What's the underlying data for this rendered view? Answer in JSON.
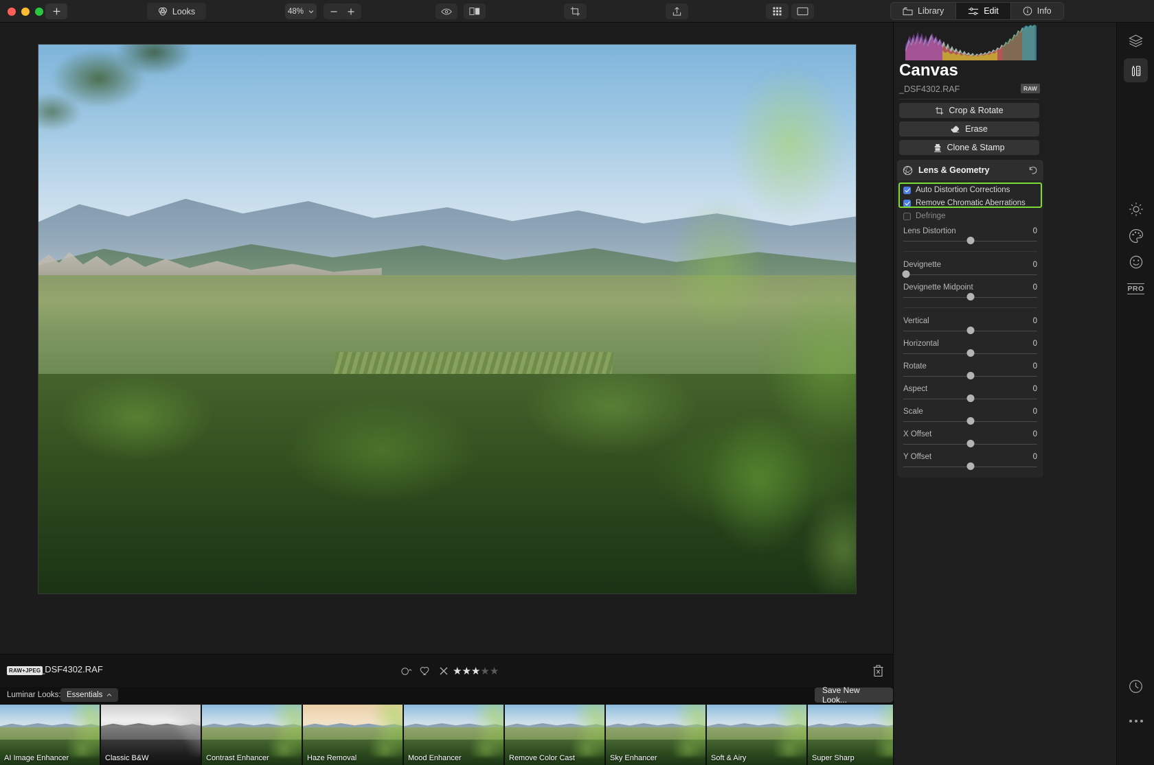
{
  "titlebar": {
    "add_label": "+",
    "looks_label": "Looks",
    "zoom_label": "48%",
    "minus_label": "−",
    "plus_label": "+",
    "icons": {
      "eye": "eye-icon",
      "compare": "before-after-icon",
      "crop": "crop-icon",
      "share": "share-icon",
      "grid": "grid-view-icon",
      "single": "single-view-icon"
    },
    "segments": [
      {
        "label": "Library",
        "icon": "library-icon",
        "active": false
      },
      {
        "label": "Edit",
        "icon": "sliders-icon",
        "active": true
      },
      {
        "label": "Info",
        "icon": "info-icon",
        "active": false
      }
    ]
  },
  "panel": {
    "title": "Canvas",
    "filename": "_DSF4302.RAF",
    "raw_badge": "RAW",
    "tools": [
      {
        "label": "Crop & Rotate",
        "icon": "crop-icon"
      },
      {
        "label": "Erase",
        "icon": "eraser-icon"
      },
      {
        "label": "Clone & Stamp",
        "icon": "stamp-icon"
      }
    ],
    "module": {
      "title": "Lens & Geometry",
      "icon": "aperture-icon",
      "reset_icon": "reset-arrow-icon",
      "highlight_color": "#7ddb34",
      "checkboxes": [
        {
          "label": "Auto Distortion Corrections",
          "checked": true,
          "dim": false
        },
        {
          "label": "Remove Chromatic Aberrations",
          "checked": true,
          "dim": false
        },
        {
          "label": "Defringe",
          "checked": false,
          "dim": true
        }
      ],
      "sliders": [
        {
          "name": "Lens Distortion",
          "value": "0",
          "pos": 50
        },
        {
          "name": "Devignette",
          "value": "0",
          "pos": 2
        },
        {
          "name": "Devignette Midpoint",
          "value": "0",
          "pos": 50
        },
        {
          "name": "Vertical",
          "value": "0",
          "pos": 50
        },
        {
          "name": "Horizontal",
          "value": "0",
          "pos": 50
        },
        {
          "name": "Rotate",
          "value": "0",
          "pos": 50
        },
        {
          "name": "Aspect",
          "value": "0",
          "pos": 50
        },
        {
          "name": "Scale",
          "value": "0",
          "pos": 50
        },
        {
          "name": "X Offset",
          "value": "0",
          "pos": 50
        },
        {
          "name": "Y Offset",
          "value": "0",
          "pos": 50
        }
      ]
    }
  },
  "rail": [
    {
      "name": "layers-icon",
      "active": false
    },
    {
      "name": "essentials-icon",
      "active": true
    },
    {
      "name": "light-icon",
      "active": false
    },
    {
      "name": "color-icon",
      "active": false
    },
    {
      "name": "portrait-icon",
      "active": false
    },
    {
      "name": "pro-icon",
      "label": "PRO",
      "active": false
    },
    {
      "name": "history-icon",
      "active": false
    },
    {
      "name": "more-icon",
      "active": false
    }
  ],
  "filebar": {
    "format_badge": "RAW+JPEG",
    "filename": "_DSF4302.RAF",
    "color_label_icon": "color-label-icon",
    "favorite_icon": "heart-icon",
    "reject_icon": "reject-x-icon",
    "stars_filled": 3,
    "stars_total": 5,
    "trash_icon": "trash-icon"
  },
  "looks": {
    "label": "Luminar Looks:",
    "category": "Essentials",
    "category_chevron": "chevron-up-icon",
    "save_label": "Save New Look...",
    "items": [
      {
        "name": "AI Image Enhancer",
        "style": "normal"
      },
      {
        "name": "Classic B&W",
        "style": "bw"
      },
      {
        "name": "Contrast Enhancer",
        "style": "normal"
      },
      {
        "name": "Haze Removal",
        "style": "warm"
      },
      {
        "name": "Mood Enhancer",
        "style": "normal"
      },
      {
        "name": "Remove Color Cast",
        "style": "normal"
      },
      {
        "name": "Sky Enhancer",
        "style": "normal"
      },
      {
        "name": "Soft & Airy",
        "style": "normal"
      },
      {
        "name": "Super Sharp",
        "style": "normal"
      }
    ]
  }
}
